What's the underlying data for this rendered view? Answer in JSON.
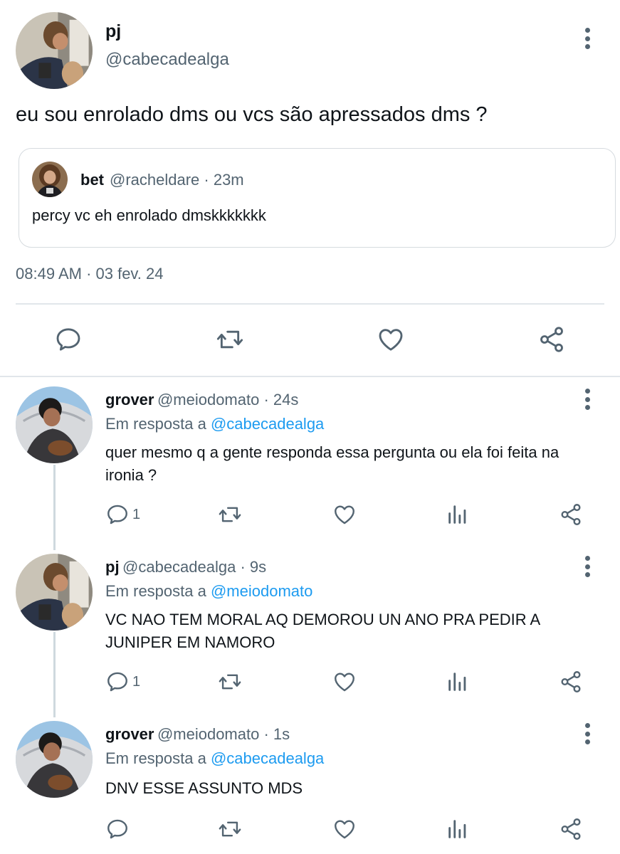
{
  "main_tweet": {
    "name": "pj",
    "handle": "@cabecadealga",
    "text": "eu sou enrolado dms ou vcs são apressados dms ?",
    "timestamp": "08:49 AM · 03 fev. 24",
    "quote": {
      "name": "bet",
      "handle": "@racheldare · 23m",
      "text": "percy vc eh enrolado dmskkkkkkk"
    }
  },
  "replies": [
    {
      "name": "grover",
      "handle": "@meiodomato · 24s",
      "reply_prefix": "Em resposta a ",
      "reply_to": "@cabecadealga",
      "text": "quer mesmo q a gente responda essa pergunta ou ela foi feita na ironia ?",
      "reply_count": "1"
    },
    {
      "name": "pj",
      "handle": "@cabecadealga · 9s",
      "reply_prefix": "Em resposta a ",
      "reply_to": "@meiodomato",
      "text": "VC NAO TEM MORAL AQ DEMOROU UN ANO PRA PEDIR A JUNIPER EM NAMORO",
      "reply_count": "1"
    },
    {
      "name": "grover",
      "handle": "@meiodomato · 1s",
      "reply_prefix": "Em resposta a ",
      "reply_to": "@cabecadealga",
      "text": "DNV ESSE ASSUNTO MDS",
      "reply_count": ""
    }
  ],
  "icons": [
    "more-vert-icon",
    "reply-icon",
    "retweet-icon",
    "like-icon",
    "share-icon",
    "views-icon"
  ],
  "colors": {
    "link": "#1d9bf0",
    "secondary": "#536471",
    "text": "#0f1419"
  }
}
